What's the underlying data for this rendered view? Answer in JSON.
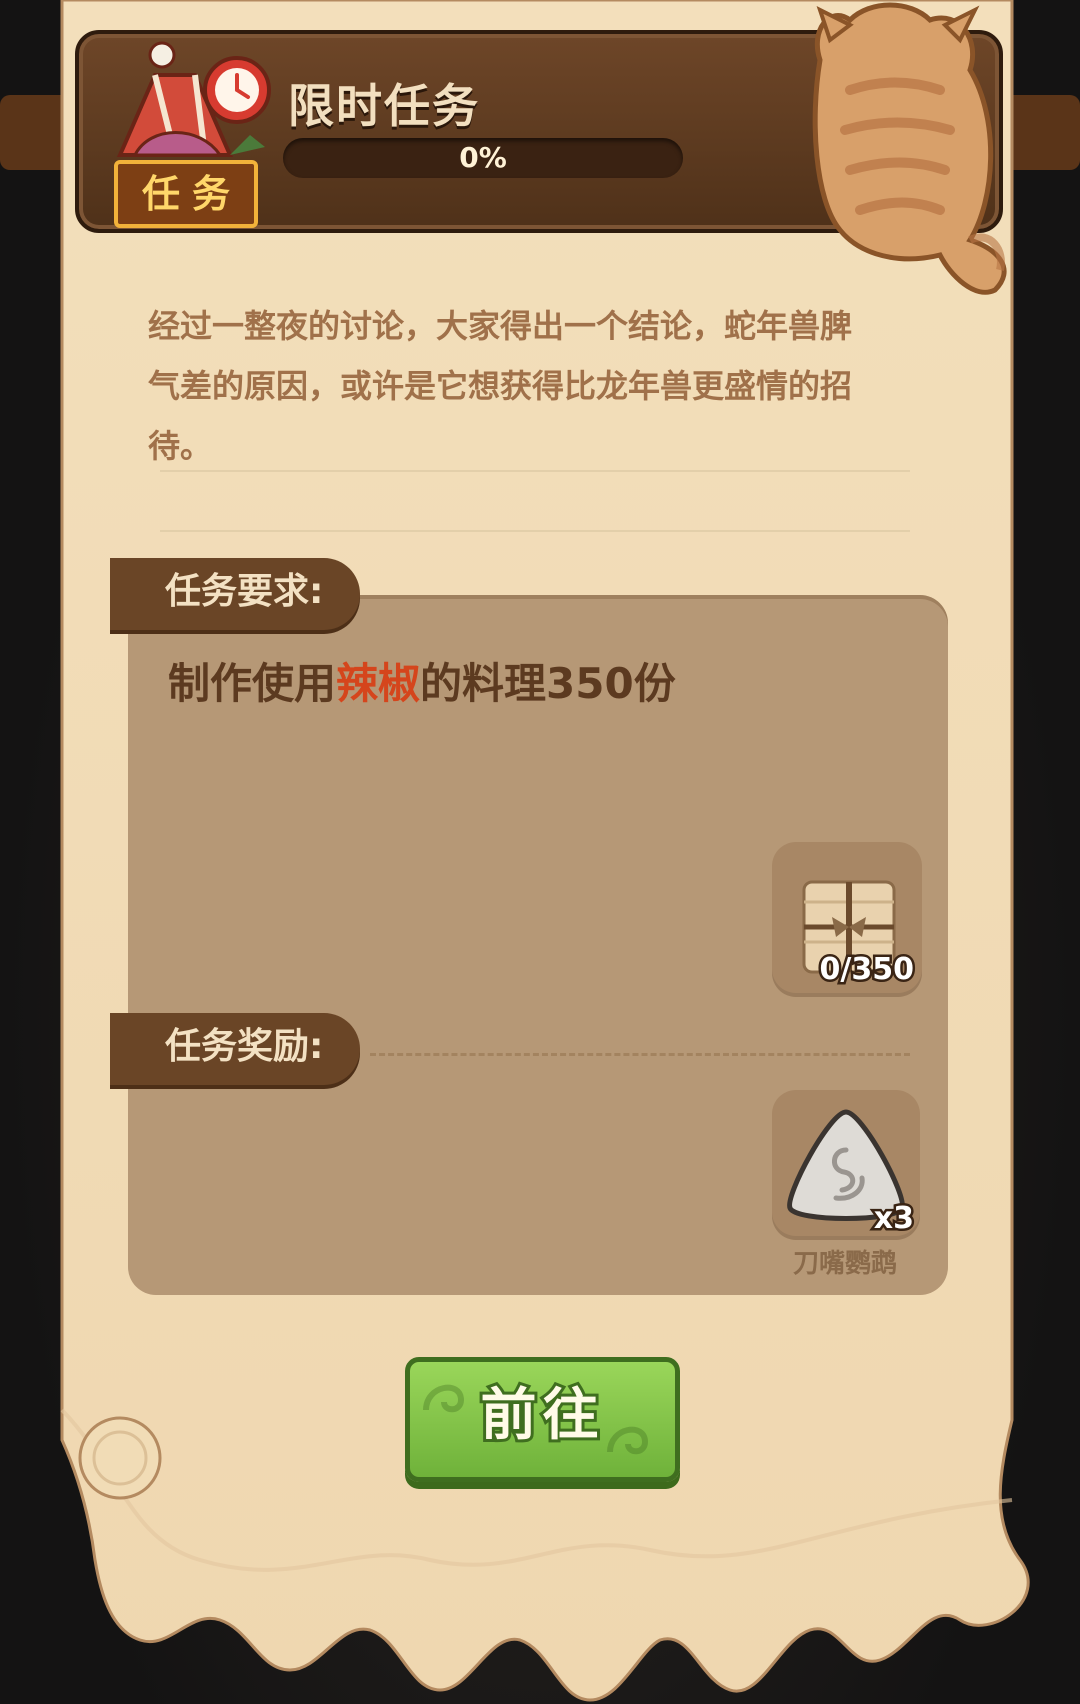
{
  "header": {
    "title": "限时任务",
    "progress_value": 0,
    "progress_text": "0%",
    "badge_label": "任务",
    "badge_icon": "tent-clock-icon"
  },
  "description": {
    "lines": [
      "经过一整夜的讨论，大家得出一个结论，蛇年兽脾",
      "气差的原因，或许是它想获得比龙年兽更盛情的招",
      "待。"
    ]
  },
  "requirement": {
    "label": "任务要求:",
    "text_prefix": "制作使用",
    "text_highlight": "辣椒",
    "text_suffix": "的料理350份",
    "highlight_color": "#d5451c",
    "item_icon": "wrapped-package-icon",
    "item_progress": "0/350"
  },
  "reward": {
    "label": "任务奖励:",
    "item_icon": "silver-rice-ball-icon",
    "quantity": "x3",
    "name": "刀嘴鹦鹉"
  },
  "go_button": {
    "label": "前往",
    "color": "#7cc245"
  }
}
